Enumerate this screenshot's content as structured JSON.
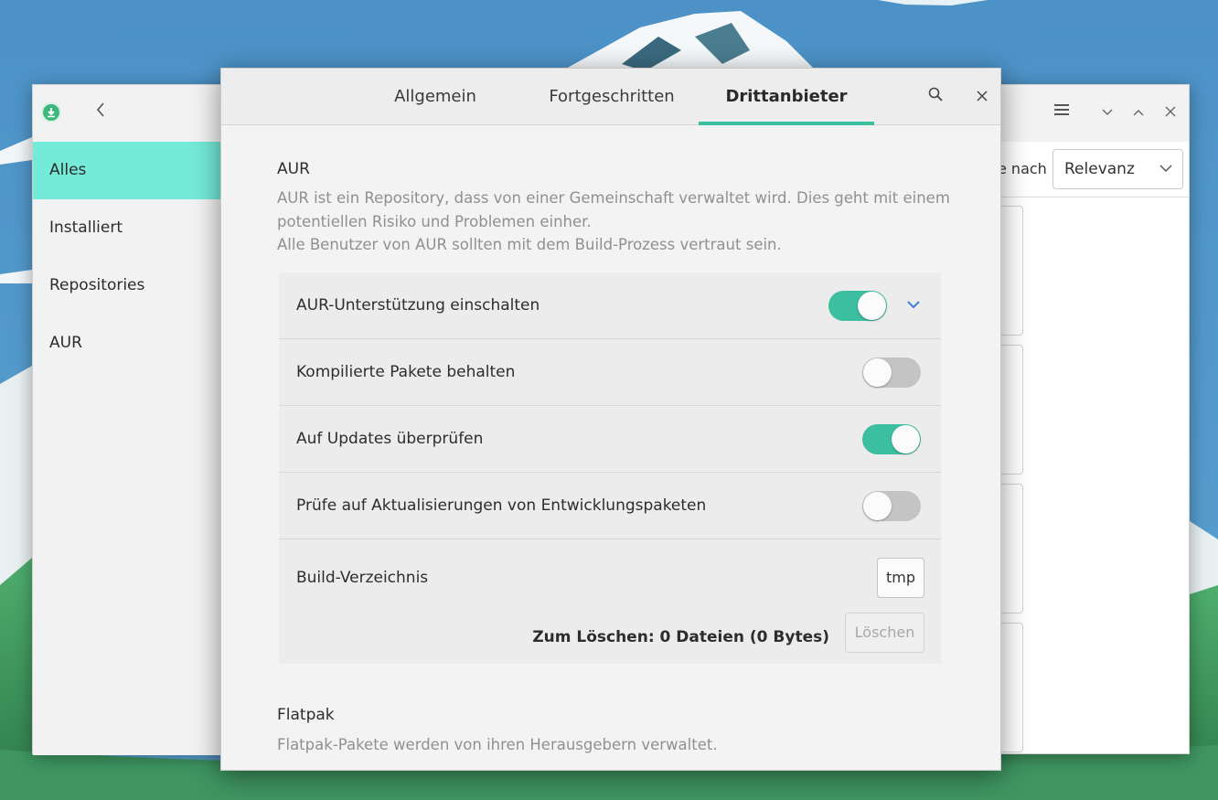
{
  "main_window": {
    "sidebar_items": [
      {
        "label": "Alles",
        "active": true
      },
      {
        "label": "Installiert",
        "active": false
      },
      {
        "label": "Repositories",
        "active": false
      },
      {
        "label": "AUR",
        "active": false
      }
    ],
    "sort_label": "e nach",
    "sort_value": "Relevanz"
  },
  "dialog": {
    "tabs": [
      {
        "label": "Allgemein",
        "active": false
      },
      {
        "label": "Fortgeschritten",
        "active": false
      },
      {
        "label": "Drittanbieter",
        "active": true
      }
    ],
    "aur": {
      "title": "AUR",
      "description_line1": "AUR ist ein Repository, dass von einer Gemeinschaft verwaltet wird. Dies geht mit einem",
      "description_line2": "potentiellen Risiko und Problemen einher.",
      "description_line3": "Alle Benutzer von AUR sollten mit dem Build-Prozess vertraut sein.",
      "settings": [
        {
          "label": "AUR-Unterstützung einschalten",
          "enabled": true
        },
        {
          "label": "Kompilierte Pakete behalten",
          "enabled": false
        },
        {
          "label": "Auf Updates überprüfen",
          "enabled": true
        },
        {
          "label": "Prüfe auf Aktualisierungen von Entwicklungspaketen",
          "enabled": false
        }
      ],
      "build_dir_label": "Build-Verzeichnis",
      "build_dir_value": "tmp",
      "clean_info": "Zum Löschen:  0 Dateien  (0 Bytes)",
      "clean_button": "Löschen"
    },
    "flatpak": {
      "title": "Flatpak",
      "description": "Flatpak-Pakete werden von ihren Herausgebern verwaltet."
    }
  },
  "colors": {
    "accent": "#3cbfa0",
    "sidebar_active": "#74ead8",
    "chevron": "#3b82d6"
  },
  "icons": {
    "app": "download-circle-icon",
    "back": "chevron-left-icon",
    "menu": "hamburger-menu-icon",
    "minimize": "chevron-down-icon",
    "maximize": "chevron-up-icon",
    "close": "close-icon",
    "search": "search-icon",
    "expand": "chevron-down-icon"
  }
}
